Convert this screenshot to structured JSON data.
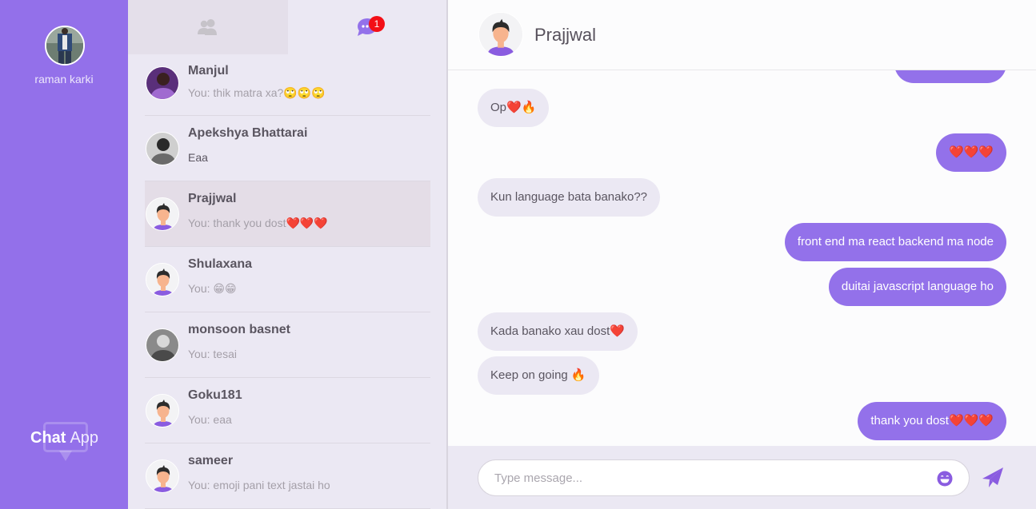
{
  "user": {
    "name": "raman karki"
  },
  "logo": {
    "bold": "Chat",
    "thin": "App"
  },
  "tabs": {
    "contacts": {
      "icon": "users-icon"
    },
    "chats": {
      "icon": "chat-bubble-icon",
      "badge": "1"
    }
  },
  "conversations": [
    {
      "name": "Manjul",
      "preview": "You: thik matra xa?🙄🙄🙄",
      "avatar": "photo",
      "unread": false,
      "active": false
    },
    {
      "name": "Apekshya Bhattarai",
      "preview": "Eaa",
      "avatar": "photo",
      "unread": true,
      "active": false
    },
    {
      "name": "Prajjwal",
      "preview": "You: thank you dost❤️❤️❤️",
      "avatar": "default",
      "unread": false,
      "active": true
    },
    {
      "name": "Shulaxana",
      "preview": "You: 😁😁",
      "avatar": "default",
      "unread": false,
      "active": false
    },
    {
      "name": "monsoon basnet",
      "preview": "You: tesai",
      "avatar": "photo",
      "unread": false,
      "active": false
    },
    {
      "name": "Goku181",
      "preview": "You: eaa",
      "avatar": "default",
      "unread": false,
      "active": false
    },
    {
      "name": "sameer",
      "preview": "You: emoji pani text jastai ho",
      "avatar": "default",
      "unread": false,
      "active": false
    }
  ],
  "chat": {
    "title": "Prajjwal",
    "messages": [
      {
        "direction": "out",
        "text": ""
      },
      {
        "direction": "in",
        "text": "Op❤️🔥"
      },
      {
        "direction": "out",
        "text": "❤️❤️❤️"
      },
      {
        "direction": "in",
        "text": "Kun language bata banako??"
      },
      {
        "direction": "out",
        "text": "front end ma react backend ma node"
      },
      {
        "direction": "out",
        "text": "duitai javascript language ho"
      },
      {
        "direction": "in",
        "text": "Kada banako xau dost❤️"
      },
      {
        "direction": "in",
        "text": "Keep on going 🔥"
      },
      {
        "direction": "out",
        "text": "thank you dost❤️❤️❤️"
      }
    ]
  },
  "composer": {
    "placeholder": "Type message...",
    "value": ""
  },
  "colors": {
    "accent": "#9371ea",
    "badge": "#f30f16",
    "panel": "#ebe8f3"
  }
}
